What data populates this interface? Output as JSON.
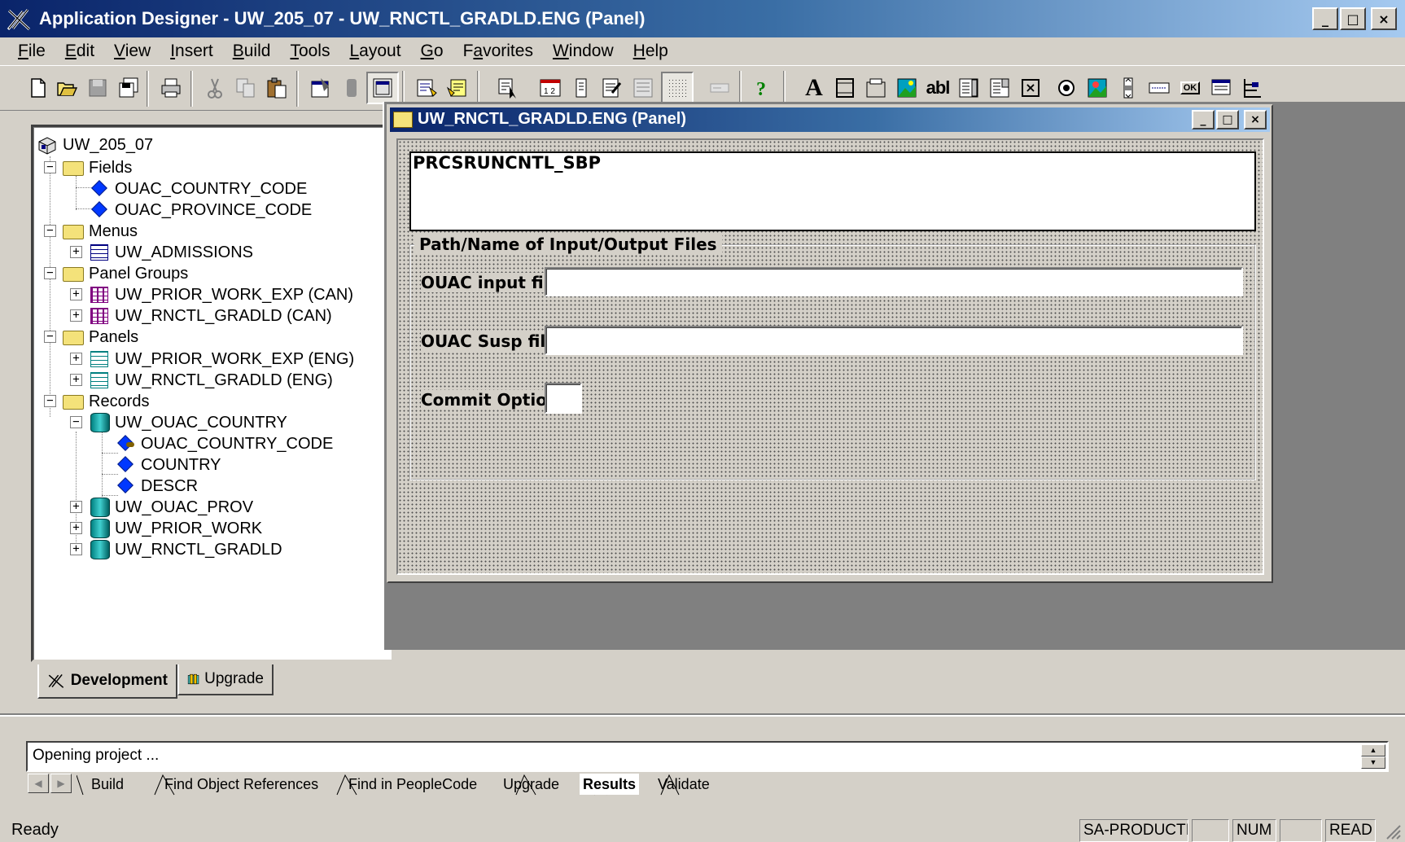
{
  "window": {
    "title": "Application Designer - UW_205_07 - UW_RNCTL_GRADLD.ENG (Panel)",
    "min": "_",
    "max": "□",
    "close": "×"
  },
  "menu": [
    {
      "label": "File",
      "u": "F",
      "rest": "ile"
    },
    {
      "label": "Edit",
      "u": "E",
      "rest": "dit"
    },
    {
      "label": "View",
      "u": "V",
      "rest": "iew"
    },
    {
      "label": "Insert",
      "u": "I",
      "rest": "nsert"
    },
    {
      "label": "Build",
      "u": "B",
      "rest": "uild"
    },
    {
      "label": "Tools",
      "u": "T",
      "rest": "ools"
    },
    {
      "label": "Layout",
      "u": "L",
      "rest": "ayout"
    },
    {
      "label": "Go",
      "u": "G",
      "rest": "o"
    },
    {
      "label": "Favorites",
      "u": "a",
      "pre": "F",
      "rest": "vorites"
    },
    {
      "label": "Window",
      "u": "W",
      "rest": "indow"
    },
    {
      "label": "Help",
      "u": "H",
      "rest": "elp"
    }
  ],
  "toolbar": {
    "text_tool": "A",
    "edit_box_tool": "abl",
    "help_glyph": "?",
    "check_glyph": "×",
    "ok_glyph": "OK"
  },
  "tree": {
    "root": "UW_205_07",
    "fields_folder": "Fields",
    "fields": [
      "OUAC_COUNTRY_CODE",
      "OUAC_PROVINCE_CODE"
    ],
    "menus_folder": "Menus",
    "menus": [
      "UW_ADMISSIONS"
    ],
    "panel_groups_folder": "Panel Groups",
    "panel_groups": [
      "UW_PRIOR_WORK_EXP (CAN)",
      "UW_RNCTL_GRADLD (CAN)"
    ],
    "panels_folder": "Panels",
    "panels": [
      "UW_PRIOR_WORK_EXP (ENG)",
      "UW_RNCTL_GRADLD (ENG)"
    ],
    "records_folder": "Records",
    "record_expanded": "UW_OUAC_COUNTRY",
    "record_fields": [
      "OUAC_COUNTRY_CODE",
      "COUNTRY",
      "DESCR"
    ],
    "records_other": [
      "UW_OUAC_PROV",
      "UW_PRIOR_WORK",
      "UW_RNCTL_GRADLD"
    ]
  },
  "project_tabs": {
    "development": "Development",
    "upgrade": "Upgrade"
  },
  "panel_window": {
    "title": "UW_RNCTL_GRADLD.ENG (Panel)",
    "subpanel": "PRCSRUNCNTL_SBP",
    "group_title": "Path/Name of Input/Output Files",
    "input_label": "OUAC input file:",
    "susp_label": "OUAC Susp file:",
    "commit_label": "Commit Option:"
  },
  "output": {
    "message": "Opening project ...",
    "tabs": [
      "Build",
      "Find Object References",
      "Find in PeopleCode",
      "Upgrade",
      "Results",
      "Validate"
    ],
    "active_tab": "Results"
  },
  "status": {
    "ready": "Ready",
    "db": "SA-PRODUCTI",
    "num": "NUM",
    "read": "READ"
  },
  "colors": {
    "title_active": "#0a246a",
    "face": "#d4d0c8",
    "mdi_bg": "#808080"
  }
}
